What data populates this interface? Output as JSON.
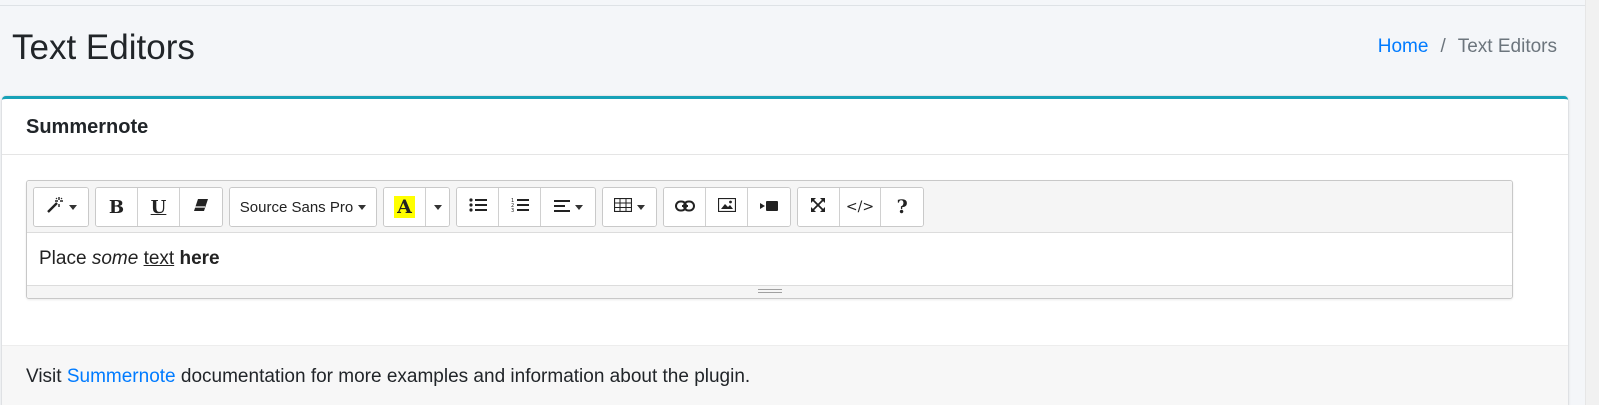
{
  "header": {
    "title": "Text Editors",
    "breadcrumb": {
      "home": "Home",
      "separator": "/",
      "current": "Text Editors"
    }
  },
  "card": {
    "title": "Summernote",
    "accent_color": "#17a2b8"
  },
  "toolbar": {
    "style_icon": "magic-wand-icon",
    "font_name": "Source Sans Pro",
    "color_letter": "A",
    "color_highlight": "#ffff00",
    "code_view_label": "</>",
    "help_label": "?",
    "bold_label": "B",
    "underline_label": "U"
  },
  "editor": {
    "text_plain_1": "Place ",
    "text_italic": "some",
    "text_space_1": " ",
    "text_underline": "text",
    "text_space_2": " ",
    "text_bold": "here"
  },
  "footer": {
    "prefix": "Visit ",
    "link": "Summernote",
    "suffix": " documentation for more examples and information about the plugin."
  },
  "colors": {
    "link": "#007bff",
    "muted": "#6c757d",
    "background": "#f4f6f9"
  }
}
